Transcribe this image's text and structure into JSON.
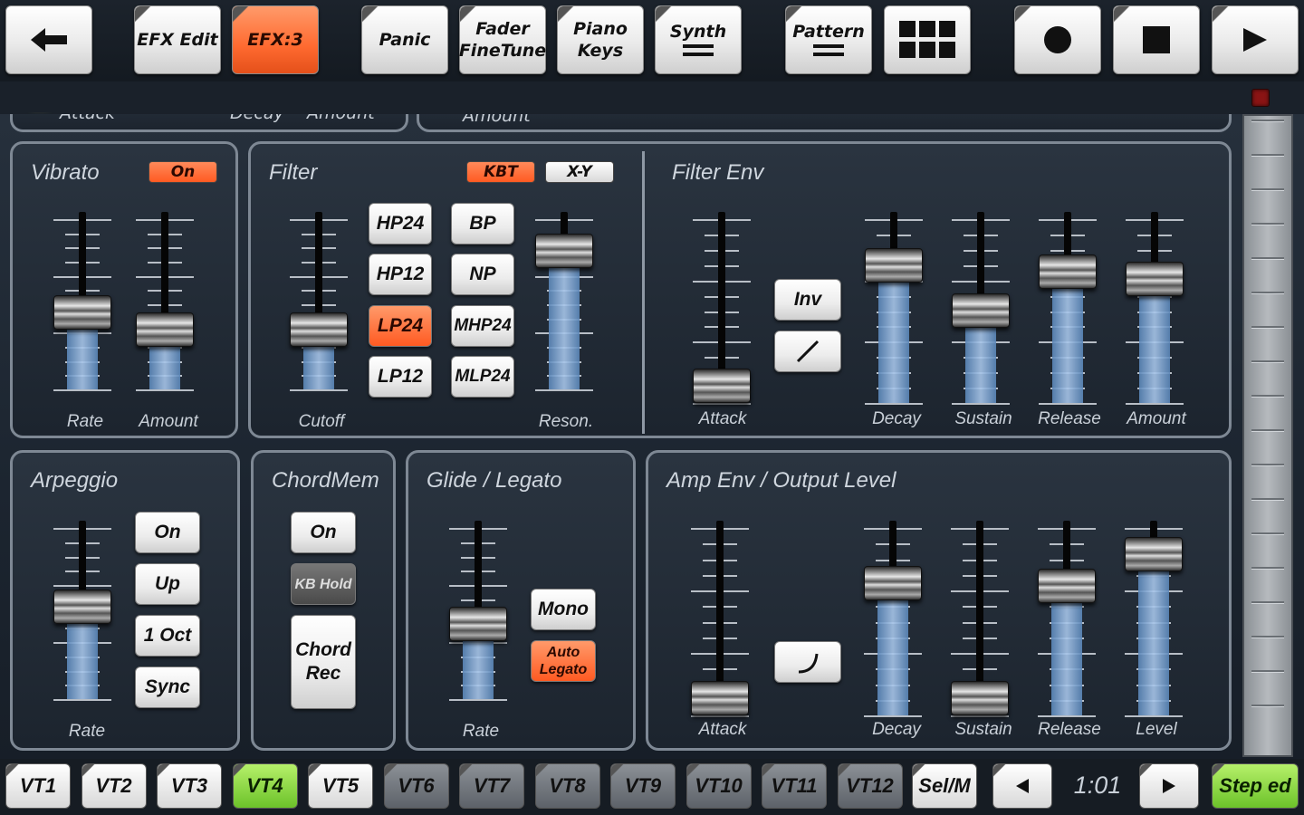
{
  "toolbar": {
    "efx_edit": "EFX Edit",
    "efx3": "EFX:3",
    "panic": "Panic",
    "fader_finetune": "Fader FineTune",
    "piano_keys": "Piano Keys",
    "synth": "Synth",
    "pattern": "Pattern"
  },
  "track_number": "1",
  "partial_labels": {
    "a": "Attack",
    "b": "Decay",
    "c": "Amount",
    "d": "Amount"
  },
  "vibrato": {
    "title": "Vibrato",
    "on": "On",
    "rate": "Rate",
    "amount": "Amount",
    "rate_level": 0.42,
    "amount_level": 0.3
  },
  "filter": {
    "title": "Filter",
    "kbt": "KBT",
    "xy": "X-Y",
    "cutoff": "Cutoff",
    "reson": "Reson.",
    "types": [
      "HP24",
      "BP",
      "HP12",
      "NP",
      "LP24",
      "MHP24",
      "LP12",
      "MLP24"
    ],
    "selected": "LP24",
    "cutoff_level": 0.3,
    "reson_level": 0.85
  },
  "filter_env": {
    "title": "Filter Env",
    "inv": "Inv",
    "labels": [
      "Attack",
      "Decay",
      "Sustain",
      "Release",
      "Amount"
    ],
    "levels": [
      0.0,
      0.77,
      0.48,
      0.73,
      0.68
    ]
  },
  "arpeggio": {
    "title": "Arpeggio",
    "on": "On",
    "up": "Up",
    "oct": "1 Oct",
    "sync": "Sync",
    "rate": "Rate",
    "rate_level": 0.52
  },
  "chordmem": {
    "title": "ChordMem",
    "on": "On",
    "kb_hold": "KB Hold",
    "chord_rec": "Chord Rec"
  },
  "glide": {
    "title": "Glide / Legato",
    "mono": "Mono",
    "auto_legato": "Auto Legato",
    "rate": "Rate",
    "rate_level": 0.4
  },
  "amp_env": {
    "title": "Amp Env / Output Level",
    "labels": [
      "Attack",
      "Decay",
      "Sustain",
      "Release",
      "Level"
    ],
    "levels": [
      0.0,
      0.72,
      0.0,
      0.7,
      0.9
    ]
  },
  "bottom": {
    "tracks": [
      "VT1",
      "VT2",
      "VT3",
      "VT4",
      "VT5",
      "VT6",
      "VT7",
      "VT8",
      "VT9",
      "VT10",
      "VT11",
      "VT12"
    ],
    "selected_track": "VT4",
    "sel_m": "Sel/M",
    "position": "1:01",
    "step_ed": "Step ed"
  }
}
